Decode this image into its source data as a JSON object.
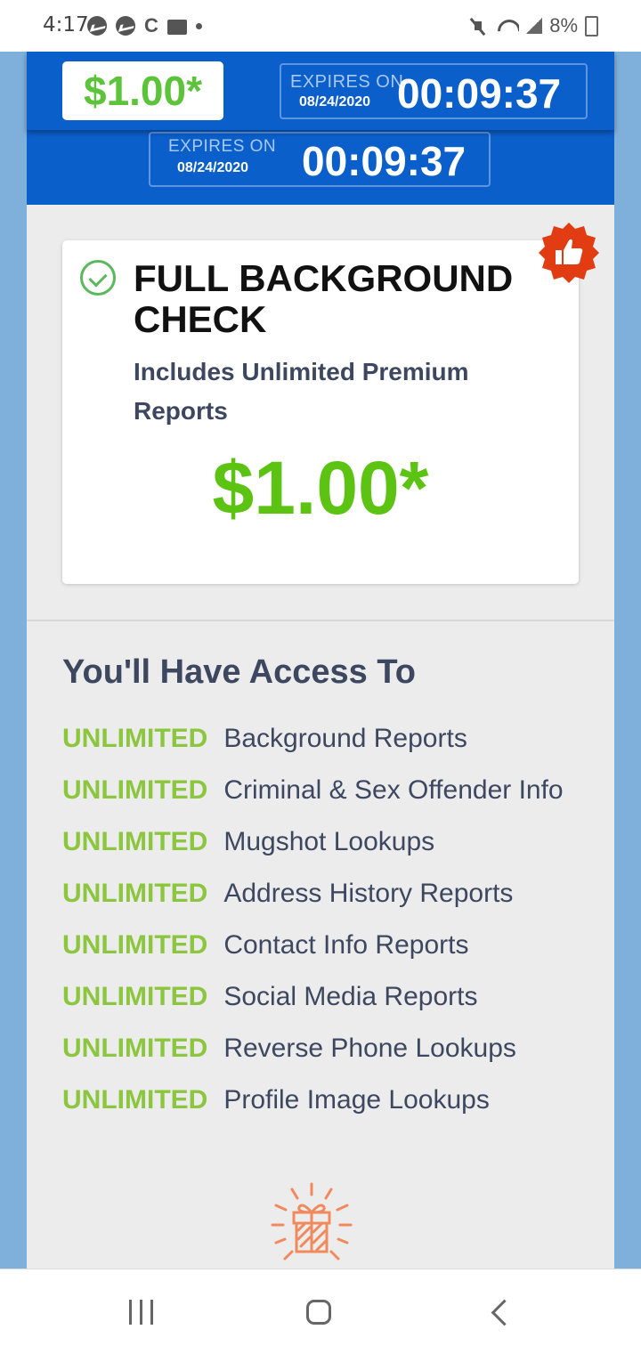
{
  "status_bar": {
    "time": "4:17",
    "battery": "8%"
  },
  "sticky_bar": {
    "price": "$1.00*",
    "expires_label": "EXPIRES ON",
    "expires_date": "08/24/2020",
    "countdown": "00:09:37"
  },
  "hero": {
    "expires_label": "EXPIRES ON",
    "expires_date": "08/24/2020",
    "countdown": "00:09:37"
  },
  "plan": {
    "title": "FULL BACKGROUND CHECK",
    "subtitle": "Includes Unlimited Premium Reports",
    "price": "$1.00*"
  },
  "access": {
    "heading": "You'll Have Access To",
    "items": [
      {
        "tag": "UNLIMITED",
        "label": "Background Reports"
      },
      {
        "tag": "UNLIMITED",
        "label": "Criminal & Sex Offender Info"
      },
      {
        "tag": "UNLIMITED",
        "label": "Mugshot Lookups"
      },
      {
        "tag": "UNLIMITED",
        "label": "Address History Reports"
      },
      {
        "tag": "UNLIMITED",
        "label": "Contact Info Reports"
      },
      {
        "tag": "UNLIMITED",
        "label": "Social Media Reports"
      },
      {
        "tag": "UNLIMITED",
        "label": "Reverse Phone Lookups"
      },
      {
        "tag": "UNLIMITED",
        "label": "Profile Image Lookups"
      }
    ]
  },
  "colors": {
    "brand_blue": "#0b5fcb",
    "price_green": "#5cc313",
    "unlimited_green": "#8cc63f",
    "badge_red": "#e23d12",
    "text_navy": "#3d4860"
  },
  "icons": [
    "messenger-icon",
    "c-app-icon",
    "folder-icon",
    "mute-icon",
    "wifi-icon",
    "signal-icon",
    "battery-icon",
    "check-circle-icon",
    "thumbs-up-badge-icon",
    "gift-icon",
    "recent-apps-icon",
    "home-icon",
    "back-icon"
  ]
}
